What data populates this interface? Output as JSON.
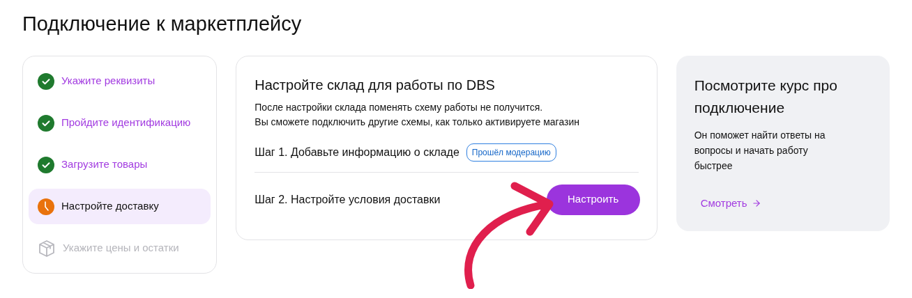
{
  "page_title": "Подключение к маркетплейсу",
  "steps": [
    {
      "label": "Укажите реквизиты",
      "kind": "done",
      "selected": false
    },
    {
      "label": "Пройдите идентификацию",
      "kind": "done",
      "selected": false
    },
    {
      "label": "Загрузите товары",
      "kind": "done",
      "selected": false
    },
    {
      "label": "Настройте доставку",
      "kind": "current",
      "selected": true
    },
    {
      "label": "Укажите цены и остатки",
      "kind": "locked",
      "selected": false
    }
  ],
  "main_card": {
    "title": "Настройте склад для работы по DBS",
    "description": [
      "После настройки склада поменять схему работы не получится.",
      "Вы сможете подключить другие схемы, как только активируете магазин"
    ],
    "stages": [
      {
        "label": "Шаг 1. Добавьте информацию о складе",
        "kind": "badge",
        "badge": "Прошёл модерацию"
      },
      {
        "label": "Шаг 2. Настройте условия доставки",
        "kind": "action",
        "button": "Настроить"
      }
    ]
  },
  "course_card": {
    "title": "Посмотрите курс про подключение",
    "text": "Он поможет найти ответы на вопросы и начать работу быстрее",
    "link": "Смотреть"
  }
}
